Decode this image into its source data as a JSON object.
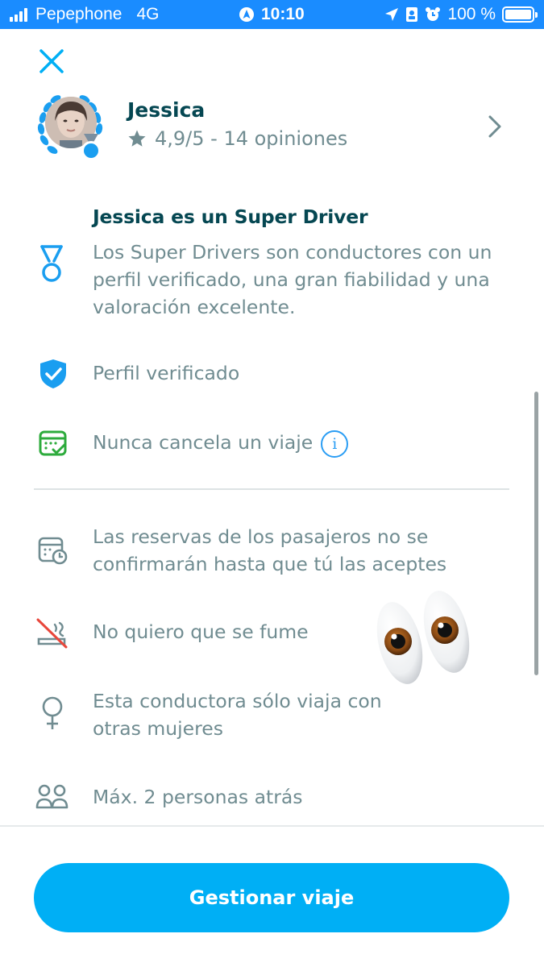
{
  "status_bar": {
    "carrier": "Pepephone",
    "network": "4G",
    "time": "10:10",
    "battery": "100 %"
  },
  "driver": {
    "name": "Jessica",
    "rating": "4,9/5 - 14 opiniones"
  },
  "super_driver": {
    "title": "Jessica es un Super Driver",
    "description": "Los Super Drivers son conductores con un perfil verificado, una gran fiabilidad y una valoración excelente."
  },
  "features": {
    "verified": "Perfil verificado",
    "never_cancels": "Nunca cancela un viaje",
    "bookings": "Las reservas de los pasajeros no se confirmarán hasta que tú las aceptes",
    "no_smoking": "No quiero que se fume",
    "women_only": "Esta conductora sólo viaja con otras mujeres",
    "max_back": "Máx. 2 personas atrás"
  },
  "cta": {
    "label": "Gestionar viaje"
  },
  "colors": {
    "status_bar": "#1a8cff",
    "accent": "#00aff5",
    "title_text": "#054752",
    "body_text": "#708c91",
    "verified_blue": "#2a9df4",
    "calendar_green": "#2dab3c"
  },
  "icons": [
    "close-icon",
    "laurel-badge-icon",
    "star-icon",
    "chevron-right-icon",
    "medal-icon",
    "shield-check-icon",
    "calendar-check-icon",
    "info-icon",
    "calendar-clock-icon",
    "no-smoking-icon",
    "female-icon",
    "people-icon",
    "eyes-emoji"
  ]
}
